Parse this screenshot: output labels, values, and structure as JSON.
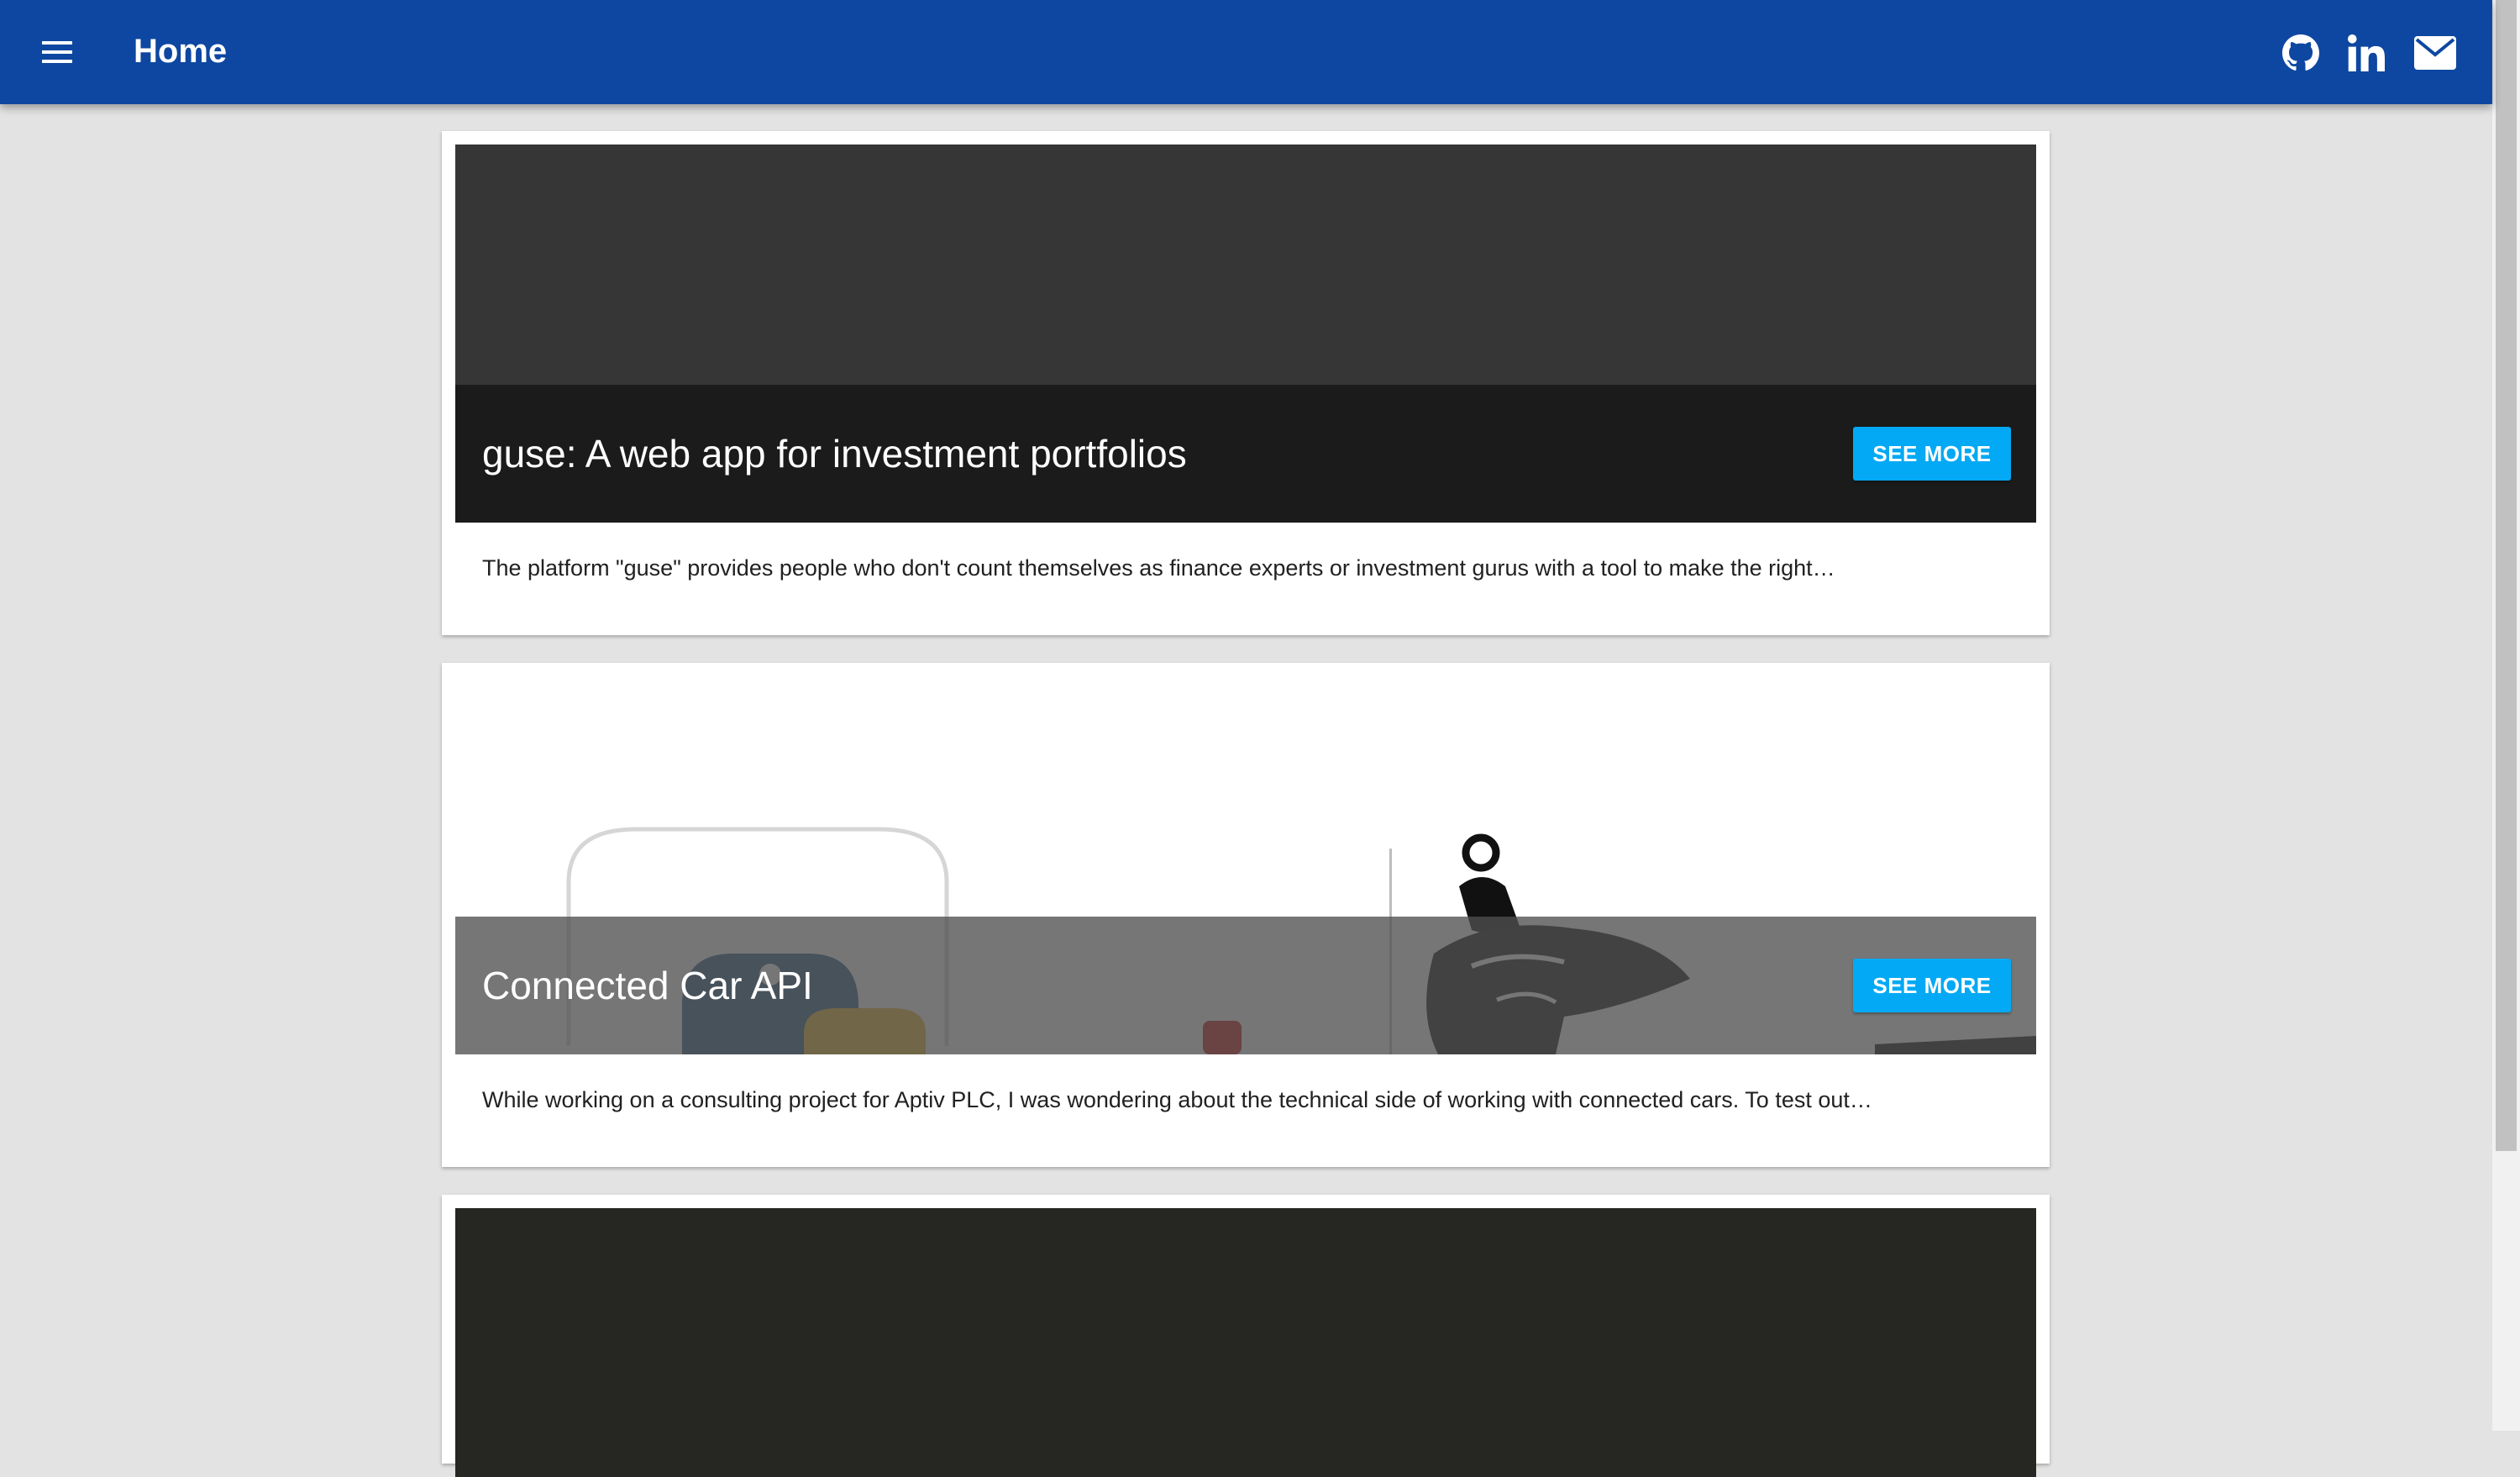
{
  "appbar": {
    "title": "Home",
    "background": "#0d47a1",
    "menu_icon": "hamburger-menu-icon",
    "social": [
      {
        "icon": "github-icon"
      },
      {
        "icon": "linkedin-icon"
      },
      {
        "icon": "email-icon"
      }
    ]
  },
  "cards": [
    {
      "title": "guse: A web app for investment portfolios",
      "button_label": "SEE MORE",
      "description": "The platform \"guse\" provides people who don't count themselves as finance experts or investment gurus with a tool to make the right…"
    },
    {
      "title": "Connected Car API",
      "button_label": "SEE MORE",
      "description": "While working on a consulting project for Aptiv PLC, I was wondering about the technical side of working with connected cars. To test out…"
    },
    {
      "title": "",
      "button_label": "",
      "description": ""
    }
  ],
  "colors": {
    "accent_button": "#03a9f4",
    "page_background": "#e3e3e3"
  }
}
